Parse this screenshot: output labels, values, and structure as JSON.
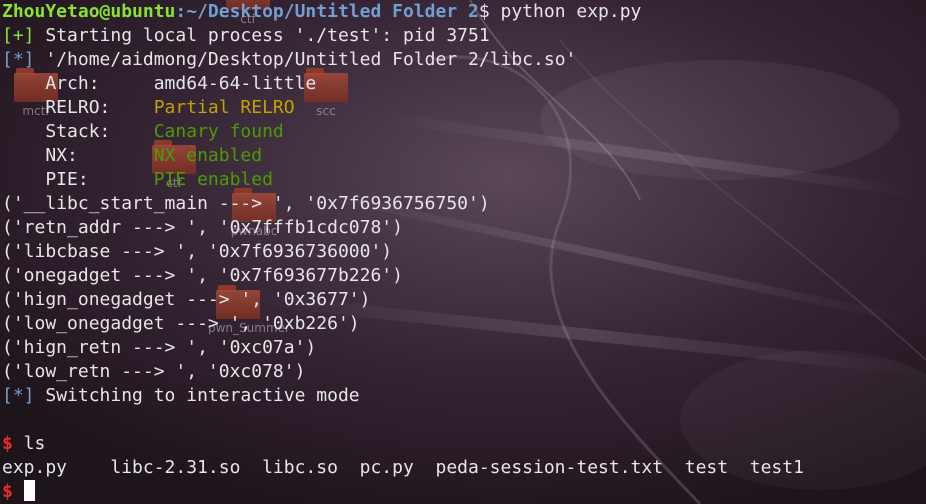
{
  "desktop": {
    "icons": [
      {
        "label": "mctf"
      },
      {
        "label": "scc"
      },
      {
        "label": "ctf"
      },
      {
        "label": "pwnabc"
      },
      {
        "label": "pwn_Summer"
      },
      {
        "label": "ctf"
      }
    ]
  },
  "terminal": {
    "prompt": {
      "user_host": "ZhouYetao@ubuntu",
      "path": ":~/Desktop/Untitled Folder 2",
      "dollar": "$",
      "command": " python exp.py"
    },
    "lines": [
      {
        "marker": "[+]",
        "text": " Starting local process './test': pid 3751"
      },
      {
        "marker": "[*]",
        "text": " '/home/aidmong/Desktop/Untitled Folder 2/libc.so'"
      }
    ],
    "checksec": [
      {
        "key": "    Arch:     ",
        "value": "amd64-64-little",
        "color": "#e6e6e6"
      },
      {
        "key": "    RELRO:    ",
        "value": "Partial RELRO",
        "color": "#c4a000"
      },
      {
        "key": "    Stack:    ",
        "value": "Canary found",
        "color": "#4e9a06"
      },
      {
        "key": "    NX:       ",
        "value": "NX enabled",
        "color": "#4e9a06"
      },
      {
        "key": "    PIE:      ",
        "value": "PIE enabled",
        "color": "#4e9a06"
      }
    ],
    "output": [
      "('__libc_start_main ---> ', '0x7f6936756750')",
      "('retn_addr ---> ', '0x7fffb1cdc078')",
      "('libcbase ---> ', '0x7f6936736000')",
      "('onegadget ---> ', '0x7f693677b226')",
      "('hign_onegadget ---> ', '0x3677')",
      "('low_onegadget ---> ', '0xb226')",
      "('hign_retn ---> ', '0xc07a')",
      "('low_retn ---> ', '0xc078')"
    ],
    "interactive": {
      "marker": "[*]",
      "text": " Switching to interactive mode"
    },
    "ls_prompt": {
      "dollar": "$",
      "command": " ls"
    },
    "ls_output": "exp.py    libc-2.31.so  libc.so  pc.py  peda-session-test.txt  test  test1",
    "final_prompt": {
      "dollar": "$"
    }
  },
  "colors": {
    "green_prompt": "#8ae234",
    "blue_path": "#729fcf",
    "orange": "#c4a000",
    "green": "#4e9a06",
    "red_prompt": "#ef2929"
  }
}
